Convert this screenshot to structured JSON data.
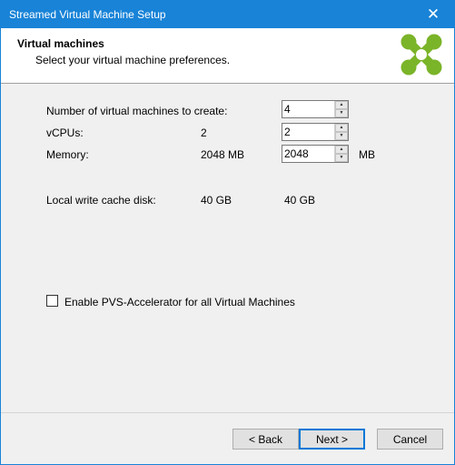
{
  "window": {
    "title": "Streamed Virtual Machine Setup",
    "close_glyph": "✕"
  },
  "header": {
    "title": "Virtual machines",
    "subtitle": "Select your virtual machine preferences.",
    "logo_icon": "citrix-x-logo-icon",
    "logo_color": "#7ab428"
  },
  "form": {
    "num_vms": {
      "label": "Number of virtual machines to create:",
      "value": "4"
    },
    "vcpus": {
      "label": "vCPUs:",
      "template_value": "2",
      "value": "2"
    },
    "memory": {
      "label": "Memory:",
      "template_value": "2048 MB",
      "value": "2048",
      "unit": "MB"
    },
    "cache_disk": {
      "label": "Local write cache disk:",
      "template_value": "40 GB",
      "value": "40 GB"
    },
    "pvs_accelerator": {
      "label": "Enable PVS-Accelerator for all Virtual Machines",
      "checked": false
    }
  },
  "buttons": {
    "back": "< Back",
    "next": "Next >",
    "cancel": "Cancel"
  }
}
